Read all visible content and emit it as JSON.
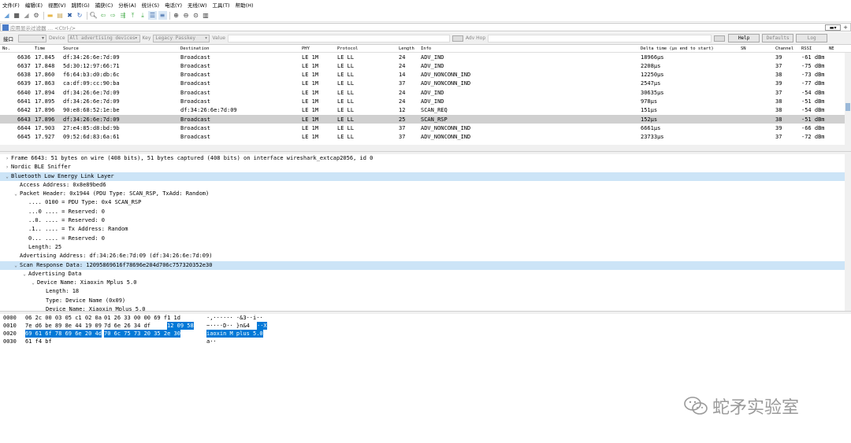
{
  "menu": [
    "文件(F)",
    "编辑(E)",
    "视图(V)",
    "跳转(G)",
    "捕获(C)",
    "分析(A)",
    "统计(S)",
    "电话(Y)",
    "无线(W)",
    "工具(T)",
    "帮助(H)"
  ],
  "filter": {
    "placeholder": "应用显示过滤器 … <Ctrl-/>"
  },
  "iface": {
    "label": "接口",
    "device_label": "Device",
    "device_value": "All advertising devices",
    "key_label": "Key",
    "key_value": "Legacy Passkey",
    "value_label": "Value",
    "advhop_label": "Adv Hop",
    "help": "Help",
    "defaults": "Defaults",
    "log": "Log"
  },
  "columns": [
    "No.",
    "Time",
    "Source",
    "Destination",
    "PHY",
    "Protocol",
    "Length",
    "Info",
    "Delta time (µs end to start)",
    "SN",
    "Channel",
    "RSSI",
    "NE"
  ],
  "packets": [
    {
      "no": "6636",
      "time": "17.845",
      "src": "df:34:26:6e:7d:09",
      "dst": "Broadcast",
      "phy": "LE 1M",
      "proto": "LE LL",
      "len": "24",
      "info": "ADV_IND",
      "delta": "18966µs",
      "ch": "39",
      "rssi": "-61 dBm"
    },
    {
      "no": "6637",
      "time": "17.848",
      "src": "5d:30:12:97:66:71",
      "dst": "Broadcast",
      "phy": "LE 1M",
      "proto": "LE LL",
      "len": "24",
      "info": "ADV_IND",
      "delta": "2208µs",
      "ch": "37",
      "rssi": "-75 dBm"
    },
    {
      "no": "6638",
      "time": "17.860",
      "src": "f6:64:b3:d0:db:6c",
      "dst": "Broadcast",
      "phy": "LE 1M",
      "proto": "LE LL",
      "len": "14",
      "info": "ADV_NONCONN_IND",
      "delta": "12250µs",
      "ch": "38",
      "rssi": "-73 dBm"
    },
    {
      "no": "6639",
      "time": "17.863",
      "src": "ca:df:09:cc:90:ba",
      "dst": "Broadcast",
      "phy": "LE 1M",
      "proto": "LE LL",
      "len": "37",
      "info": "ADV_NONCONN_IND",
      "delta": "2547µs",
      "ch": "39",
      "rssi": "-77 dBm"
    },
    {
      "no": "6640",
      "time": "17.894",
      "src": "df:34:26:6e:7d:09",
      "dst": "Broadcast",
      "phy": "LE 1M",
      "proto": "LE LL",
      "len": "24",
      "info": "ADV_IND",
      "delta": "30635µs",
      "ch": "37",
      "rssi": "-54 dBm"
    },
    {
      "no": "6641",
      "time": "17.895",
      "src": "df:34:26:6e:7d:09",
      "dst": "Broadcast",
      "phy": "LE 1M",
      "proto": "LE LL",
      "len": "24",
      "info": "ADV_IND",
      "delta": "978µs",
      "ch": "38",
      "rssi": "-51 dBm"
    },
    {
      "no": "6642",
      "time": "17.896",
      "src": "90:e8:68:52:1e:be",
      "dst": "df:34:26:6e:7d:09",
      "phy": "LE 1M",
      "proto": "LE LL",
      "len": "12",
      "info": "SCAN_REQ",
      "delta": "151µs",
      "ch": "38",
      "rssi": "-54 dBm"
    },
    {
      "no": "6643",
      "time": "17.896",
      "src": "df:34:26:6e:7d:09",
      "dst": "Broadcast",
      "phy": "LE 1M",
      "proto": "LE LL",
      "len": "25",
      "info": "SCAN_RSP",
      "delta": "152µs",
      "ch": "38",
      "rssi": "-51 dBm"
    },
    {
      "no": "6644",
      "time": "17.903",
      "src": "27:e4:85:d8:bd:9b",
      "dst": "Broadcast",
      "phy": "LE 1M",
      "proto": "LE LL",
      "len": "37",
      "info": "ADV_NONCONN_IND",
      "delta": "6661µs",
      "ch": "39",
      "rssi": "-66 dBm"
    },
    {
      "no": "6645",
      "time": "17.927",
      "src": "09:52:6d:83:6a:61",
      "dst": "Broadcast",
      "phy": "LE 1M",
      "proto": "LE LL",
      "len": "37",
      "info": "ADV_NONCONN_IND",
      "delta": "23733µs",
      "ch": "37",
      "rssi": "-72 dBm"
    }
  ],
  "details": [
    {
      "indent": 0,
      "arrow": "›",
      "text": "Frame 6643: 51 bytes on wire (408 bits), 51 bytes captured (408 bits) on interface wireshark_extcap2056, id 0"
    },
    {
      "indent": 0,
      "arrow": "›",
      "text": "Nordic BLE Sniffer"
    },
    {
      "indent": 0,
      "arrow": "⌄",
      "text": "Bluetooth Low Energy Link Layer",
      "hl": true
    },
    {
      "indent": 1,
      "arrow": "",
      "text": "Access Address: 0x8e89bed6"
    },
    {
      "indent": 1,
      "arrow": "⌄",
      "text": "Packet Header: 0x1944 (PDU Type: SCAN_RSP, TxAdd: Random)"
    },
    {
      "indent": 2,
      "arrow": "",
      "text": ".... 0100 = PDU Type: 0x4 SCAN_RSP"
    },
    {
      "indent": 2,
      "arrow": "",
      "text": "...0 .... = Reserved: 0"
    },
    {
      "indent": 2,
      "arrow": "",
      "text": "..0. .... = Reserved: 0"
    },
    {
      "indent": 2,
      "arrow": "",
      "text": ".1.. .... = Tx Address: Random"
    },
    {
      "indent": 2,
      "arrow": "",
      "text": "0... .... = Reserved: 0"
    },
    {
      "indent": 2,
      "arrow": "",
      "text": "Length: 25"
    },
    {
      "indent": 1,
      "arrow": "",
      "text": "Advertising Address: df:34:26:6e:7d:09 (df:34:26:6e:7d:09)"
    },
    {
      "indent": 1,
      "arrow": "⌄",
      "text": "Scan Response Data: 12095869616f78696e204d706c757320352e30",
      "hl": true
    },
    {
      "indent": 2,
      "arrow": "⌄",
      "text": "Advertising Data"
    },
    {
      "indent": 3,
      "arrow": "⌄",
      "text": "Device Name: Xiaoxin Mplus 5.0"
    },
    {
      "indent": 4,
      "arrow": "",
      "text": "Length: 18"
    },
    {
      "indent": 4,
      "arrow": "",
      "text": "Type: Device Name (0x09)"
    },
    {
      "indent": 4,
      "arrow": "",
      "text": "Device Name: Xiaoxin Mplus 5.0"
    }
  ],
  "bytes": [
    {
      "off": "0000",
      "hex_a": "06 2c 00 03 05 c1 02 0a",
      "hex_b": "01 26 33 00 00 69 f1 1d",
      "ascii": "·,······ ·&3··i··"
    },
    {
      "off": "0010",
      "hex_a": "7e d6 be 89 8e 44 19 09",
      "hex_b": "7d 6e 26 34 df",
      "hex_hi": "12 09 58",
      "ascii": "~····D·· }n&4",
      "ascii_hi": "··X"
    },
    {
      "off": "0020",
      "hex_hi_a": "69 61 6f 78 69 6e 20 4d",
      "hex_hi_b": "70 6c 75 73 20 35 2e 30",
      "ascii_hi": "iaoxin M plus 5.0"
    },
    {
      "off": "0030",
      "hex_a": "61 f4 bf",
      "hex_b": "",
      "ascii": "a··"
    }
  ],
  "watermark": "蛇矛实验室"
}
